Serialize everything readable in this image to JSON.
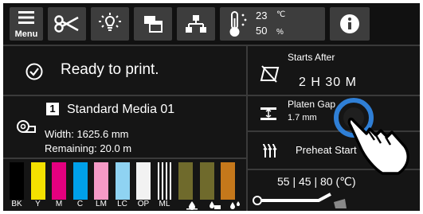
{
  "toolbar": {
    "menu_label": "Menu",
    "environment": {
      "temperature": "23",
      "temperature_unit": "℃",
      "humidity": "50",
      "humidity_unit": "%"
    }
  },
  "status": {
    "message": "Ready to print."
  },
  "media": {
    "number": "1",
    "name": "Standard Media 01",
    "width": "Width: 1625.6 mm",
    "remaining": "Remaining: 20.0 m"
  },
  "inks": [
    {
      "label": "BK",
      "color": "#000000"
    },
    {
      "label": "Y",
      "color": "#f4e100"
    },
    {
      "label": "M",
      "color": "#e4007f"
    },
    {
      "label": "C",
      "color": "#00a0e9"
    },
    {
      "label": "LM",
      "color": "#f59ac6"
    },
    {
      "label": "LC",
      "color": "#8fd3f2"
    },
    {
      "label": "OP",
      "color": "#f2f2f2"
    },
    {
      "label": "ML",
      "color": "#ffffff"
    },
    {
      "label": "",
      "color": "#6f6a2c"
    },
    {
      "label": "",
      "color": "#6f6a2c"
    },
    {
      "label": "",
      "color": "#c5781b"
    }
  ],
  "starts_after": {
    "title": "Starts After",
    "time": "2 H  30 M"
  },
  "platen_gap": {
    "title": "Platen Gap",
    "value": "1.7 mm"
  },
  "preheat": {
    "label": "Preheat Start"
  },
  "heater_temps": {
    "text": "55 | 45 | 80 (℃)"
  },
  "accent_color": "#2f7fd6"
}
